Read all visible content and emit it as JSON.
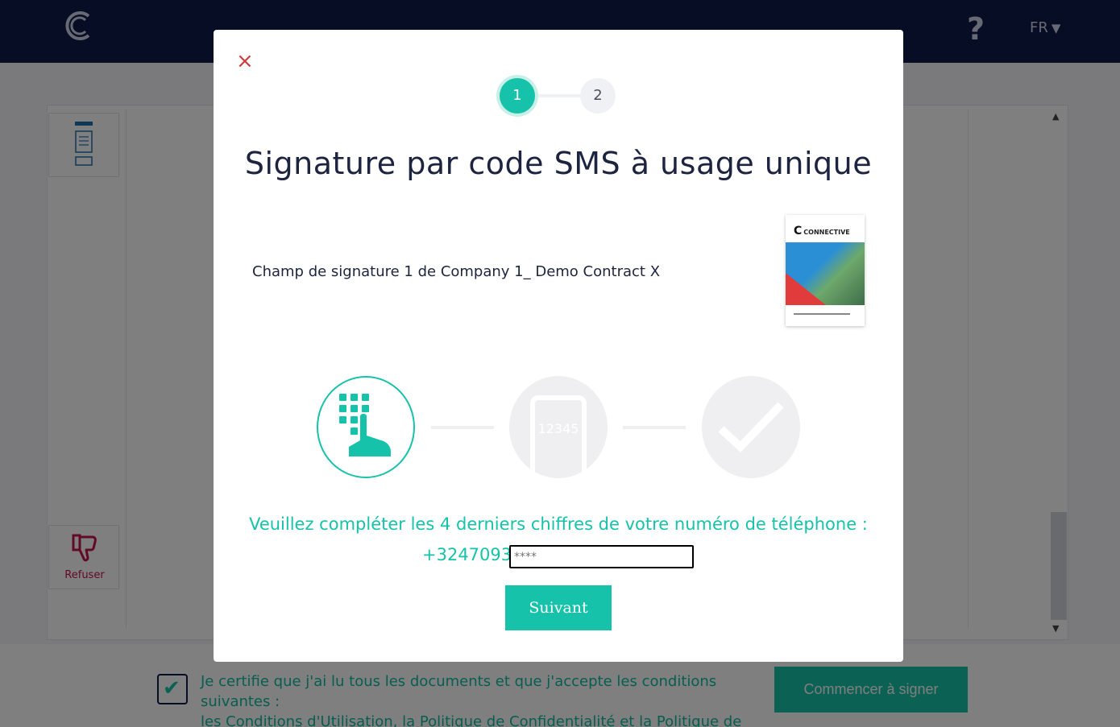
{
  "header": {
    "help_label": "?",
    "language": "FR",
    "language_caret": "▼"
  },
  "sidebar": {
    "refuse_label": "Refuser"
  },
  "footer": {
    "certify_text": "Je certifie que j'ai lu tous les documents et que j'accepte les conditions suivantes :",
    "terms_link": "les Conditions d'Utilisation",
    "separator": ",",
    "privacy_link": "la Politique de Confidentialité",
    "and_word": "et",
    "cookies_link": "la Politique de Cookies",
    "period": ".",
    "start_button": "Commencer à signer",
    "checkbox_mark": "✔"
  },
  "modal": {
    "close_label": "×",
    "steps": [
      "1",
      "2"
    ],
    "title": "Signature par code SMS à usage unique",
    "field_name": "Champ de signature 1 de Company 1_ Demo Contract X",
    "document_brand": "CONNECTIVE",
    "phone_code_sample": "12345",
    "prompt": "Veuillez compléter les 4 derniers chiffres de votre numéro de téléphone :",
    "phone_prefix": "+3247093",
    "digits_placeholder": "****",
    "next_button": "Suivant"
  },
  "colors": {
    "accent": "#16c2a9",
    "header_bg": "#0c1a4b",
    "refuse": "#c4154b",
    "close": "#d23a3a"
  }
}
